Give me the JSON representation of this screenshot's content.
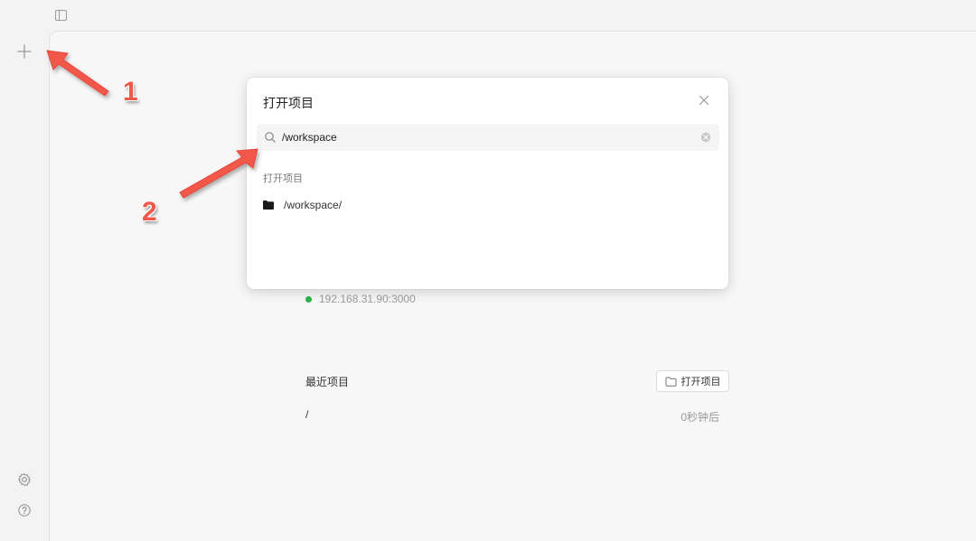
{
  "topbar": {
    "sidebar_toggle_icon": "sidebar-toggle-icon"
  },
  "rail": {
    "new_icon": "plus-icon",
    "settings_icon": "gear-icon",
    "help_icon": "question-icon"
  },
  "main": {
    "server": {
      "address": "192.168.31.90:3000",
      "status_color": "#2bb34a"
    },
    "recent": {
      "title": "最近项目",
      "open_button_label": "打开项目",
      "items": [
        {
          "path": "/",
          "time": "0秒钟后"
        }
      ]
    }
  },
  "modal": {
    "title": "打开项目",
    "search": {
      "value": "/workspace",
      "placeholder": ""
    },
    "section_label": "打开项目",
    "results": [
      {
        "label": "/workspace/",
        "icon": "folder-icon"
      }
    ]
  },
  "annotations": {
    "labels": [
      "1",
      "2"
    ],
    "arrow_color": "#f2584a"
  }
}
